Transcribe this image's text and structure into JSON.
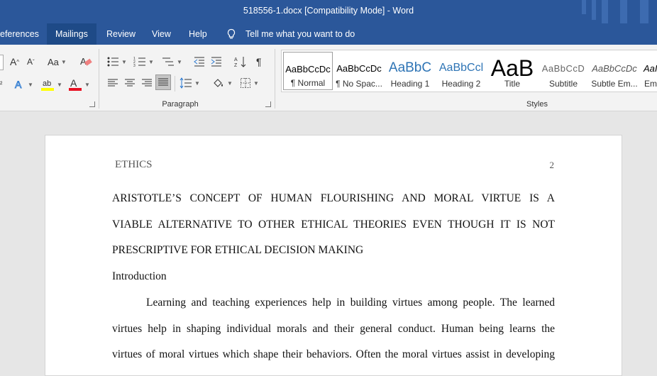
{
  "title": "518556-1.docx [Compatibility Mode]  -  Word",
  "tabs": {
    "references": "eferences",
    "mailings": "Mailings",
    "review": "Review",
    "view": "View",
    "help": "Help",
    "tell_me": "Tell me what you want to do"
  },
  "ribbon": {
    "font_case": "Aa",
    "paragraph_label": "Paragraph",
    "styles_label": "Styles",
    "styles": [
      {
        "preview": "AaBbCcDc",
        "name": "¶ Normal",
        "selected": true
      },
      {
        "preview": "AaBbCcDc",
        "name": "¶ No Spac..."
      },
      {
        "preview": "AaBbC",
        "name": "Heading 1"
      },
      {
        "preview": "AaBbCcl",
        "name": "Heading 2"
      },
      {
        "preview": "AaB",
        "name": "Title"
      },
      {
        "preview": "AaBbCcD",
        "name": "Subtitle"
      },
      {
        "preview": "AaBbCcDc",
        "name": "Subtle Em..."
      },
      {
        "preview": "AaI",
        "name": "Em"
      }
    ],
    "colors": {
      "highlight": "#ffff00",
      "font_color": "#e81123",
      "accent": "#2b579a"
    }
  },
  "document": {
    "header_left": "ETHICS",
    "page_number": "2",
    "title_lines": [
      "ARISTOTLE’S CONCEPT OF HUMAN FLOURISHING AND MORAL VIRTUE IS A",
      "VIABLE ALTERNATIVE TO OTHER ETHICAL THEORIES EVEN THOUGH IT IS NOT",
      "PRESCRIPTIVE FOR ETHICAL DECISION MAKING"
    ],
    "section_heading": "Introduction",
    "body_lines": [
      "Learning and teaching experiences help in building virtues among people. The learned",
      "virtues help in shaping individual morals and their general conduct. Human being learns the",
      "virtues of moral virtues which shape their behaviors. Often the moral virtues assist in developing"
    ]
  }
}
